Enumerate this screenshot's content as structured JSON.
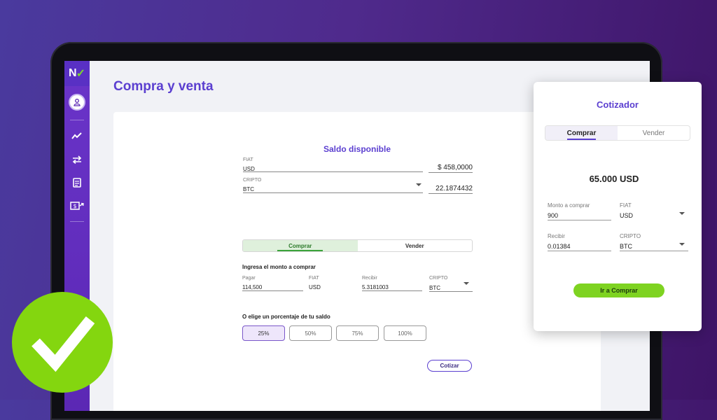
{
  "app": {
    "logo_letter": "N",
    "page_title": "Compra y venta",
    "brand_color": "#5b3fd0",
    "accent_green": "#7ed321"
  },
  "sidebar": {
    "items": [
      {
        "icon": "user-icon"
      },
      {
        "icon": "trend-chart-icon"
      },
      {
        "icon": "transfer-arrows-icon"
      },
      {
        "icon": "document-icon"
      },
      {
        "icon": "money-send-icon"
      }
    ]
  },
  "saldo": {
    "title": "Saldo disponible",
    "fiat_label": "FIAT",
    "fiat_value": "USD",
    "fiat_amount": "$ 458,0000",
    "cripto_label": "CRIPTO",
    "cripto_value": "BTC",
    "cripto_amount": "22.1874432"
  },
  "trade_tabs": {
    "comprar": "Comprar",
    "vender": "Vender"
  },
  "monto": {
    "title": "Ingresa el monto a comprar",
    "pagar_label": "Pagar",
    "pagar_value": "114,500",
    "fiat_label": "FIAT",
    "fiat_value": "USD",
    "recibir_label": "Recibir",
    "recibir_value": "5.3181003",
    "cripto_label": "CRIPTO",
    "cripto_value": "BTC"
  },
  "porcentaje": {
    "title": "O elige un porcentaje de tu saldo",
    "options": [
      "25%",
      "50%",
      "75%",
      "100%"
    ],
    "selected": "25%"
  },
  "cotizar_button": "Cotizar",
  "cotizador": {
    "title": "Cotizador",
    "tabs": {
      "comprar": "Comprar",
      "vender": "Vender"
    },
    "amount": "65.000 USD",
    "monto_label": "Monto a comprar",
    "monto_value": "900",
    "fiat_label": "FIAT",
    "fiat_value": "USD",
    "recibir_label": "Recibir",
    "recibir_value": "0.01384",
    "cripto_label": "CRIPTO",
    "cripto_value": "BTC",
    "button": "Ir a Comprar"
  },
  "badge": {
    "icon": "checkmark-icon"
  }
}
